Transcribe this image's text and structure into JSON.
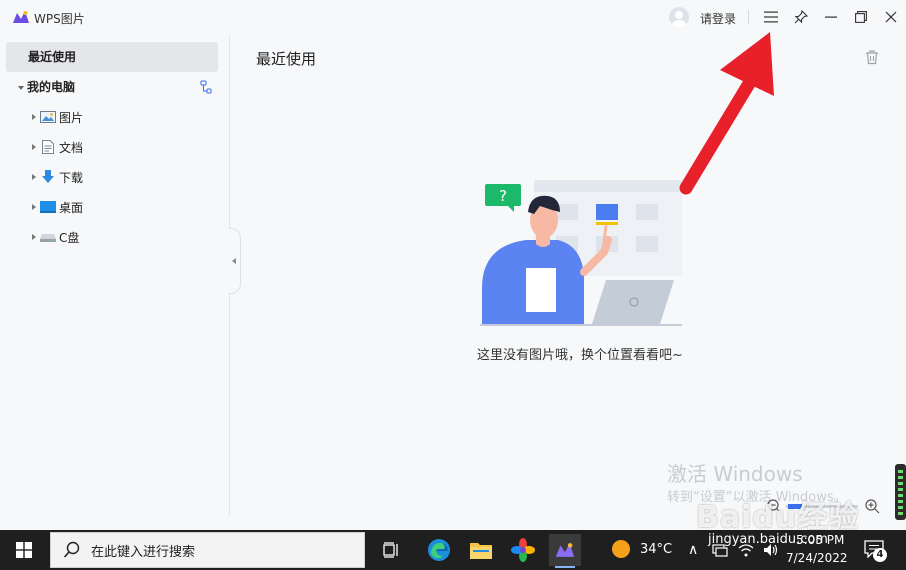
{
  "window": {
    "title": "WPS图片",
    "login_label": "请登录"
  },
  "sidebar": {
    "recent_label": "最近使用",
    "root_label": "我的电脑",
    "items": [
      {
        "label": "图片",
        "icon": "picture-folder-icon"
      },
      {
        "label": "文档",
        "icon": "document-folder-icon"
      },
      {
        "label": "下载",
        "icon": "download-folder-icon"
      },
      {
        "label": "桌面",
        "icon": "desktop-folder-icon"
      },
      {
        "label": "C盘",
        "icon": "drive-icon"
      }
    ]
  },
  "main": {
    "title": "最近使用",
    "empty_message": "这里没有图片哦，换个位置看看吧~",
    "bubble_mark": "?"
  },
  "overlay": {
    "activation_title": "激活 Windows",
    "activation_sub": "转到“设置”以激活 Windows。",
    "watermark_brand": "Baidu经验",
    "watermark_url": "jingyan.baidu.com"
  },
  "taskbar": {
    "search_placeholder": "在此键入进行搜索",
    "temperature": "34°C",
    "time": "5:05 PM",
    "date": "7/24/2022",
    "notification_count": "4"
  },
  "colors": {
    "accent": "#3a6df0",
    "annotation_arrow": "#e8202a",
    "taskbar": "#1f1f1f"
  }
}
